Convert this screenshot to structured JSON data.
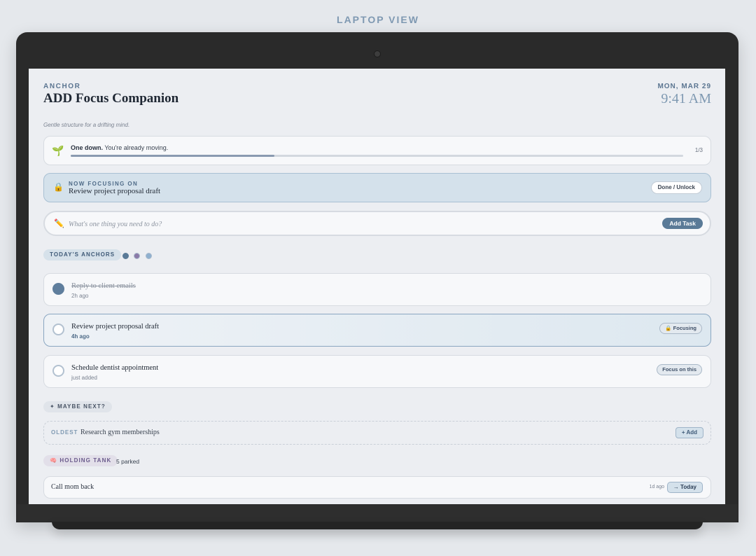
{
  "view_label": "LAPTOP VIEW",
  "header": {
    "brand": "ANCHOR",
    "title": "ADD Focus Companion",
    "tagline": "Gentle structure for a drifting mind.",
    "date": "MON, MAR 29",
    "time": "9:41 AM"
  },
  "progress": {
    "icon": "sprout-icon",
    "headline": "One down.",
    "message": "You're already moving.",
    "count": "1/3",
    "fraction": 0.333
  },
  "focus": {
    "icon": "lock-icon",
    "label": "NOW FOCUSING ON",
    "task": "Review project proposal draft",
    "button": "Done / Unlock"
  },
  "input": {
    "icon": "pencil-icon",
    "placeholder": "What's one thing you need to do?",
    "button": "Add Task"
  },
  "anchors": {
    "label": "TODAY'S ANCHORS",
    "tasks": [
      {
        "name": "Reply to client emails",
        "meta": "2h ago",
        "done": true
      },
      {
        "name": "Review project proposal draft",
        "meta": "4h ago",
        "action": "🔒 Focusing"
      },
      {
        "name": "Schedule dentist appointment",
        "meta": "just added",
        "action": "Focus on this"
      }
    ]
  },
  "maybe": {
    "label": "✦ MAYBE NEXT?",
    "tag": "OLDEST",
    "task": "Research gym memberships",
    "button": "+ Add"
  },
  "holding": {
    "label": "🧠 HOLDING TANK",
    "count": "5 parked",
    "items": [
      {
        "name": "Call mom back",
        "age": "1d ago",
        "button": "→ Today"
      }
    ]
  },
  "colors": {
    "accent": "#5a7a97",
    "focus_bg": "#d4e1eb",
    "page_bg": "#e5e8ec"
  }
}
